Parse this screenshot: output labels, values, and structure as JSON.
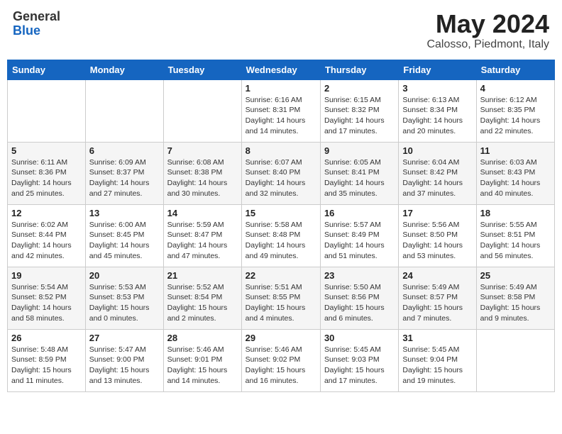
{
  "header": {
    "logo_line1": "General",
    "logo_line2": "Blue",
    "month_year": "May 2024",
    "location": "Calosso, Piedmont, Italy"
  },
  "weekdays": [
    "Sunday",
    "Monday",
    "Tuesday",
    "Wednesday",
    "Thursday",
    "Friday",
    "Saturday"
  ],
  "weeks": [
    [
      {
        "day": "",
        "info": ""
      },
      {
        "day": "",
        "info": ""
      },
      {
        "day": "",
        "info": ""
      },
      {
        "day": "1",
        "info": "Sunrise: 6:16 AM\nSunset: 8:31 PM\nDaylight: 14 hours\nand 14 minutes."
      },
      {
        "day": "2",
        "info": "Sunrise: 6:15 AM\nSunset: 8:32 PM\nDaylight: 14 hours\nand 17 minutes."
      },
      {
        "day": "3",
        "info": "Sunrise: 6:13 AM\nSunset: 8:34 PM\nDaylight: 14 hours\nand 20 minutes."
      },
      {
        "day": "4",
        "info": "Sunrise: 6:12 AM\nSunset: 8:35 PM\nDaylight: 14 hours\nand 22 minutes."
      }
    ],
    [
      {
        "day": "5",
        "info": "Sunrise: 6:11 AM\nSunset: 8:36 PM\nDaylight: 14 hours\nand 25 minutes."
      },
      {
        "day": "6",
        "info": "Sunrise: 6:09 AM\nSunset: 8:37 PM\nDaylight: 14 hours\nand 27 minutes."
      },
      {
        "day": "7",
        "info": "Sunrise: 6:08 AM\nSunset: 8:38 PM\nDaylight: 14 hours\nand 30 minutes."
      },
      {
        "day": "8",
        "info": "Sunrise: 6:07 AM\nSunset: 8:40 PM\nDaylight: 14 hours\nand 32 minutes."
      },
      {
        "day": "9",
        "info": "Sunrise: 6:05 AM\nSunset: 8:41 PM\nDaylight: 14 hours\nand 35 minutes."
      },
      {
        "day": "10",
        "info": "Sunrise: 6:04 AM\nSunset: 8:42 PM\nDaylight: 14 hours\nand 37 minutes."
      },
      {
        "day": "11",
        "info": "Sunrise: 6:03 AM\nSunset: 8:43 PM\nDaylight: 14 hours\nand 40 minutes."
      }
    ],
    [
      {
        "day": "12",
        "info": "Sunrise: 6:02 AM\nSunset: 8:44 PM\nDaylight: 14 hours\nand 42 minutes."
      },
      {
        "day": "13",
        "info": "Sunrise: 6:00 AM\nSunset: 8:45 PM\nDaylight: 14 hours\nand 45 minutes."
      },
      {
        "day": "14",
        "info": "Sunrise: 5:59 AM\nSunset: 8:47 PM\nDaylight: 14 hours\nand 47 minutes."
      },
      {
        "day": "15",
        "info": "Sunrise: 5:58 AM\nSunset: 8:48 PM\nDaylight: 14 hours\nand 49 minutes."
      },
      {
        "day": "16",
        "info": "Sunrise: 5:57 AM\nSunset: 8:49 PM\nDaylight: 14 hours\nand 51 minutes."
      },
      {
        "day": "17",
        "info": "Sunrise: 5:56 AM\nSunset: 8:50 PM\nDaylight: 14 hours\nand 53 minutes."
      },
      {
        "day": "18",
        "info": "Sunrise: 5:55 AM\nSunset: 8:51 PM\nDaylight: 14 hours\nand 56 minutes."
      }
    ],
    [
      {
        "day": "19",
        "info": "Sunrise: 5:54 AM\nSunset: 8:52 PM\nDaylight: 14 hours\nand 58 minutes."
      },
      {
        "day": "20",
        "info": "Sunrise: 5:53 AM\nSunset: 8:53 PM\nDaylight: 15 hours\nand 0 minutes."
      },
      {
        "day": "21",
        "info": "Sunrise: 5:52 AM\nSunset: 8:54 PM\nDaylight: 15 hours\nand 2 minutes."
      },
      {
        "day": "22",
        "info": "Sunrise: 5:51 AM\nSunset: 8:55 PM\nDaylight: 15 hours\nand 4 minutes."
      },
      {
        "day": "23",
        "info": "Sunrise: 5:50 AM\nSunset: 8:56 PM\nDaylight: 15 hours\nand 6 minutes."
      },
      {
        "day": "24",
        "info": "Sunrise: 5:49 AM\nSunset: 8:57 PM\nDaylight: 15 hours\nand 7 minutes."
      },
      {
        "day": "25",
        "info": "Sunrise: 5:49 AM\nSunset: 8:58 PM\nDaylight: 15 hours\nand 9 minutes."
      }
    ],
    [
      {
        "day": "26",
        "info": "Sunrise: 5:48 AM\nSunset: 8:59 PM\nDaylight: 15 hours\nand 11 minutes."
      },
      {
        "day": "27",
        "info": "Sunrise: 5:47 AM\nSunset: 9:00 PM\nDaylight: 15 hours\nand 13 minutes."
      },
      {
        "day": "28",
        "info": "Sunrise: 5:46 AM\nSunset: 9:01 PM\nDaylight: 15 hours\nand 14 minutes."
      },
      {
        "day": "29",
        "info": "Sunrise: 5:46 AM\nSunset: 9:02 PM\nDaylight: 15 hours\nand 16 minutes."
      },
      {
        "day": "30",
        "info": "Sunrise: 5:45 AM\nSunset: 9:03 PM\nDaylight: 15 hours\nand 17 minutes."
      },
      {
        "day": "31",
        "info": "Sunrise: 5:45 AM\nSunset: 9:04 PM\nDaylight: 15 hours\nand 19 minutes."
      },
      {
        "day": "",
        "info": ""
      }
    ]
  ]
}
